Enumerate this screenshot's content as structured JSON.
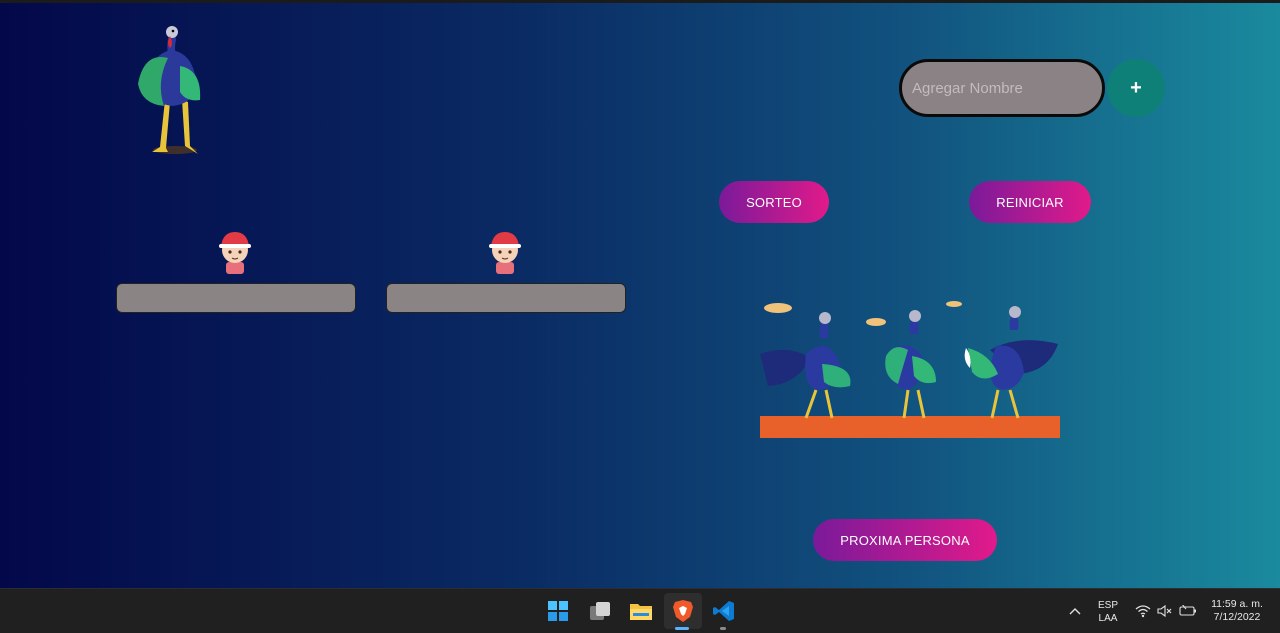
{
  "form": {
    "name_placeholder": "Agregar Nombre",
    "add_label": "+"
  },
  "buttons": {
    "draw": "SORTEO",
    "reset": "REINICIAR",
    "next": "PROXIMA PERSONA"
  },
  "taskbar": {
    "apps": [
      "start-icon",
      "task-view-icon",
      "file-explorer-icon",
      "brave-browser-icon",
      "vscode-icon"
    ],
    "lang_primary": "ESP",
    "lang_secondary": "LAA",
    "time": "11:59 a. m.",
    "date": "7/12/2022"
  },
  "colors": {
    "pill_start": "#7a1a9a",
    "pill_end": "#e11a8a",
    "add_button": "#0f8078",
    "slot": "#8b8485"
  }
}
